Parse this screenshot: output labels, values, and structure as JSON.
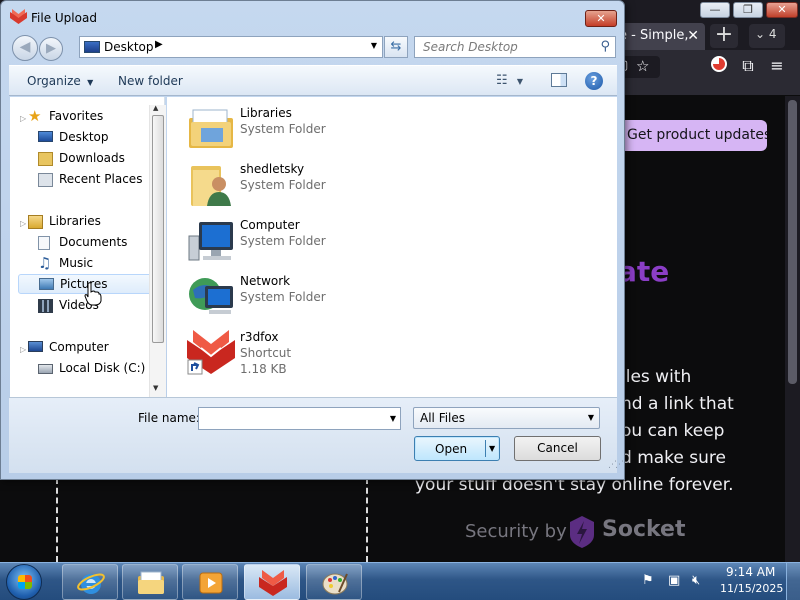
{
  "browser": {
    "tab_title": "e - Simple,",
    "tab_count": "4",
    "promo_button": "Get product updates",
    "hero_heading": "ate",
    "hero_lines": [
      "iles with",
      "nd a link that",
      "ou can keep",
      "d make sure",
      "your stuff doesn't stay online forever."
    ],
    "security_label": "Security by",
    "security_brand": "Socket"
  },
  "dialog": {
    "title": "File Upload",
    "address": "Desktop",
    "search_placeholder": "Search Desktop",
    "toolbar": {
      "organize": "Organize",
      "new_folder": "New folder"
    },
    "nav": {
      "favorites": "Favorites",
      "desktop": "Desktop",
      "downloads": "Downloads",
      "recent_places": "Recent Places",
      "libraries": "Libraries",
      "documents": "Documents",
      "music": "Music",
      "pictures": "Pictures",
      "videos": "Videos",
      "computer": "Computer",
      "local_disk": "Local Disk (C:)"
    },
    "files": [
      {
        "name": "Libraries",
        "type": "System Folder",
        "icon": "libraries-icon"
      },
      {
        "name": "shedletsky",
        "type": "System Folder",
        "icon": "user-folder-icon"
      },
      {
        "name": "Computer",
        "type": "System Folder",
        "icon": "computer-icon"
      },
      {
        "name": "Network",
        "type": "System Folder",
        "icon": "network-icon"
      },
      {
        "name": "r3dfox",
        "type": "Shortcut",
        "size": "1.18 KB",
        "icon": "r3dfox-shortcut-icon"
      }
    ],
    "footer": {
      "file_name_label": "File name:",
      "file_name_value": "",
      "file_type": "All Files",
      "open": "Open",
      "cancel": "Cancel"
    }
  },
  "taskbar": {
    "time": "9:14 AM",
    "date": "11/15/2025"
  },
  "colors": {
    "promo_button_bg": "#d6b5f4",
    "hero_heading": "#8b3ec6",
    "dialog_chrome": "#c5d8ef",
    "taskbar": "#2e5687"
  }
}
